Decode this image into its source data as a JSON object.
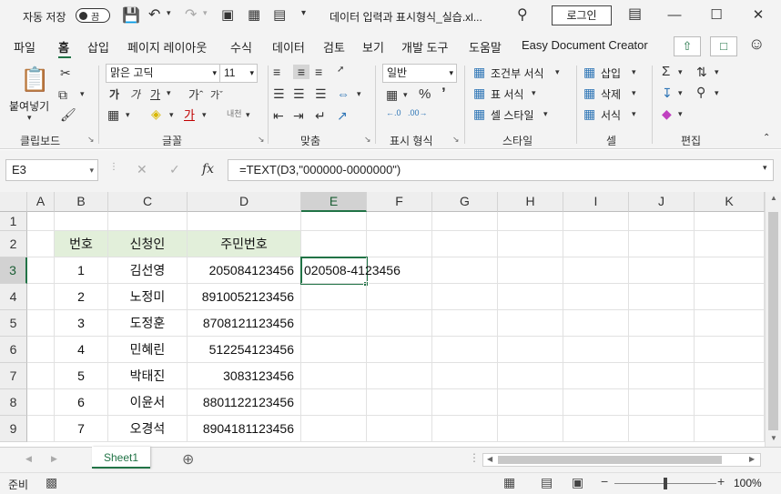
{
  "titlebar": {
    "autosave_label": "자동 저장",
    "autosave_state": "끔",
    "doc_title": "데이터 입력과 표시형식_실습.xl...",
    "login_label": "로그인"
  },
  "menu": {
    "items": [
      "파일",
      "홈",
      "삽입",
      "페이지 레이아웃",
      "수식",
      "데이터",
      "검토",
      "보기",
      "개발 도구",
      "도움말",
      "Easy Document Creator"
    ],
    "active": "홈"
  },
  "ribbon": {
    "clipboard": {
      "paste_label": "붙여넣기",
      "group_label": "클립보드"
    },
    "font": {
      "font_name": "맑은 고딕",
      "font_size": "11",
      "group_label": "글꼴"
    },
    "align": {
      "group_label": "맞춤"
    },
    "number": {
      "format": "일반",
      "group_label": "표시 형식"
    },
    "styles": {
      "conditional": "조건부 서식",
      "table_format": "표 서식",
      "cell_style": "셀 스타일",
      "group_label": "스타일"
    },
    "cells": {
      "insert": "삽입",
      "delete": "삭제",
      "format": "서식",
      "group_label": "셀"
    },
    "editing": {
      "group_label": "편집"
    }
  },
  "formula_bar": {
    "name_box": "E3",
    "formula": "=TEXT(D3,\"000000-0000000\")"
  },
  "sheet": {
    "columns": [
      "A",
      "B",
      "C",
      "D",
      "E",
      "F",
      "G",
      "H",
      "I",
      "J",
      "K"
    ],
    "rows": [
      "1",
      "2",
      "3",
      "4",
      "5",
      "6",
      "7",
      "8",
      "9"
    ],
    "header": {
      "no": "번호",
      "name": "신청인",
      "id": "주민번호"
    },
    "data": [
      {
        "no": "1",
        "name": "김선영",
        "id": "205084123456",
        "result": "020508-4123456"
      },
      {
        "no": "2",
        "name": "노정미",
        "id": "8910052123456",
        "result": ""
      },
      {
        "no": "3",
        "name": "도정훈",
        "id": "8708121123456",
        "result": ""
      },
      {
        "no": "4",
        "name": "민혜린",
        "id": "512254123456",
        "result": ""
      },
      {
        "no": "5",
        "name": "박태진",
        "id": "3083123456",
        "result": ""
      },
      {
        "no": "6",
        "name": "이윤서",
        "id": "8801122123456",
        "result": ""
      },
      {
        "no": "7",
        "name": "오경석",
        "id": "8904181123456",
        "result": ""
      }
    ]
  },
  "tabs": {
    "sheet1": "Sheet1"
  },
  "status": {
    "ready": "준비",
    "zoom": "100%"
  },
  "colors": {
    "accent": "#217346",
    "header_fill": "#e2efda"
  }
}
